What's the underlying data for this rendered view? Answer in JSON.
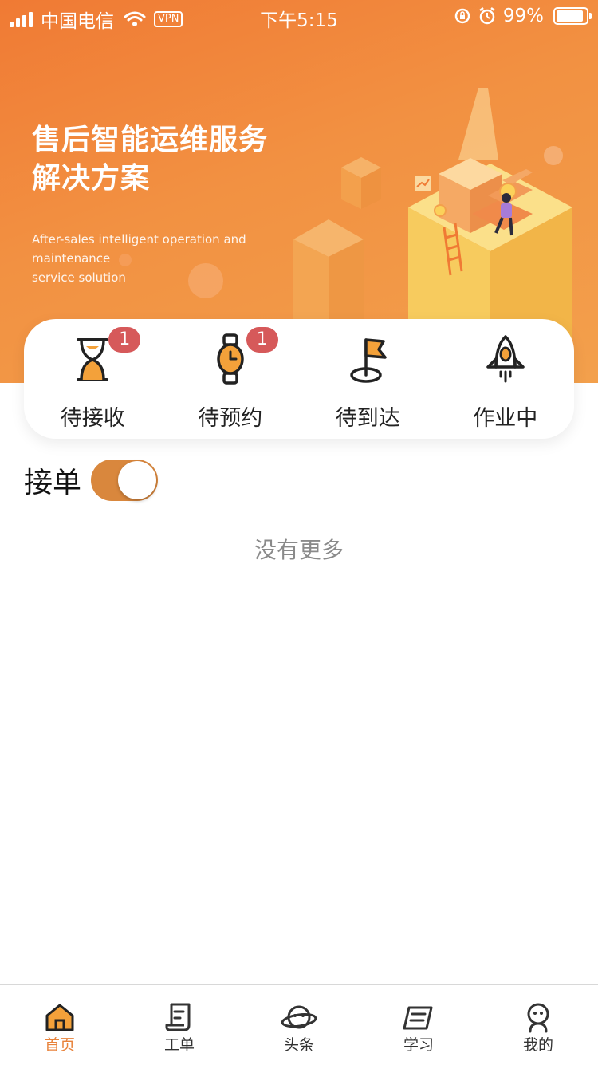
{
  "status_bar": {
    "carrier": "中国电信",
    "vpn": "VPN",
    "time": "下午5:15",
    "battery": "99%"
  },
  "hero": {
    "title_line1": "售后智能运维服务",
    "title_line2": "解决方案",
    "subtitle_line1": "After-sales intelligent operation and maintenance",
    "subtitle_line2": "service solution"
  },
  "status_tabs": [
    {
      "label": "待接收",
      "badge": "1",
      "icon": "hourglass-icon"
    },
    {
      "label": "待预约",
      "badge": "1",
      "icon": "watch-icon"
    },
    {
      "label": "待到达",
      "badge": "",
      "icon": "flag-icon"
    },
    {
      "label": "作业中",
      "badge": "",
      "icon": "rocket-icon"
    }
  ],
  "accept_orders": {
    "label": "接单",
    "enabled": true
  },
  "list_footer": "没有更多",
  "tabbar": [
    {
      "label": "首页",
      "icon": "home-icon",
      "active": true
    },
    {
      "label": "工单",
      "icon": "work-order-icon",
      "active": false
    },
    {
      "label": "头条",
      "icon": "planet-icon",
      "active": false
    },
    {
      "label": "学习",
      "icon": "book-icon",
      "active": false
    },
    {
      "label": "我的",
      "icon": "profile-icon",
      "active": false
    }
  ],
  "colors": {
    "brand_orange": "#f07a34",
    "accent": "#e8823a",
    "badge_red": "#d6595a",
    "toggle_on": "#d9873d"
  }
}
